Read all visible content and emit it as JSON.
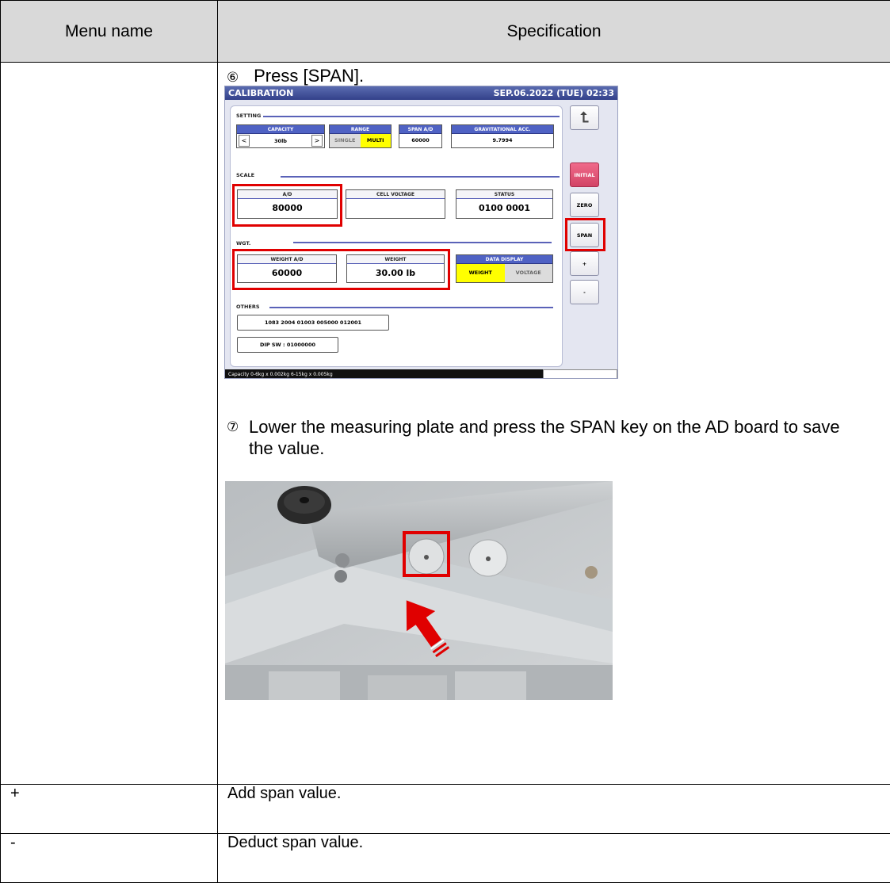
{
  "table": {
    "headers": [
      "Menu name",
      "Specification"
    ],
    "rows": [
      {
        "menu": "",
        "spec": ""
      },
      {
        "menu": "+",
        "spec": "Add span value."
      },
      {
        "menu": "-",
        "spec": "Deduct span value."
      }
    ]
  },
  "steps": [
    {
      "num": "⑥",
      "text": "Press [SPAN]."
    },
    {
      "num": "⑦",
      "text": "Lower the measuring plate and press the SPAN key on the AD board to save the value."
    }
  ],
  "screen": {
    "title": "CALIBRATION",
    "datetime": "SEP.06.2022 (TUE) 02:33",
    "setting_label": "SETTING",
    "capacity_header": "CAPACITY",
    "capacity_value": "30lb",
    "range_header": "RANGE",
    "range_single": "SINGLE",
    "range_multi": "MULTI",
    "span_ad_header": "SPAN A/D",
    "span_ad_value": "60000",
    "grav_header": "GRAVITATIONAL ACC.",
    "grav_value": "9.7994",
    "scale_label": "SCALE",
    "ad_header": "A/D",
    "ad_value": "80000",
    "cell_voltage_header": "CELL VOLTAGE",
    "cell_voltage_value": "",
    "status_header": "STATUS",
    "status_value": "0100 0001",
    "wgt_label": "WGT.",
    "weight_ad_header": "WEIGHT A/D",
    "weight_ad_value": "60000",
    "weight_header": "WEIGHT",
    "weight_value": "30.00 lb",
    "data_display_header": "DATA DISPLAY",
    "data_display_weight": "WEIGHT",
    "data_display_voltage": "VOLTAGE",
    "others_label": "OTHERS",
    "others_code": "1083 2004 01003 005000 012001",
    "dip_sw": "DIP SW : 01000000",
    "buttons": {
      "initial": "INITIAL",
      "zero": "ZERO",
      "span": "SPAN",
      "plus": "+",
      "minus": "-"
    },
    "footer": "Capacity 0-6kg x 0.002kg  6-15kg x 0.005kg",
    "colors": {
      "accent": "#4f62c4",
      "highlight": "#e00000",
      "selected": "#ffff00"
    }
  },
  "photo": {
    "description_icon": "ad-board-photo"
  }
}
